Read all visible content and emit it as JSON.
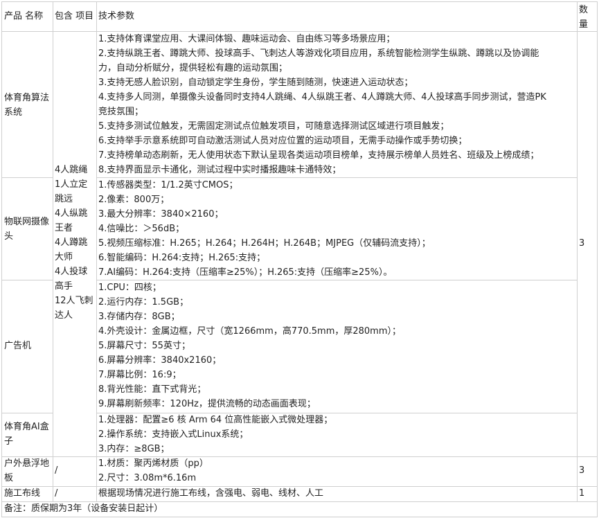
{
  "header": {
    "product_name": "产品 名称",
    "included_items": "包含 项目",
    "tech_params": "技术参数",
    "qty_line1": "数",
    "qty_line2": "量"
  },
  "rows": [
    {
      "product": [
        "体育角算法",
        "系统"
      ],
      "params": [
        "1.支持体育课堂应用、大课间体锻、趣味运动会、自由练习等多场景应用；",
        "2.支持纵跳王者、蹲跳大师、投球高手、飞刺达人等游戏化项目应用，系统智能检测学生纵跳、蹲跳以及协调能",
        "力，自动分析赋分，提供轻松有趣的运动氛围；",
        "3.支持无感人脸识别，自动锁定学生身份，学生随到随测，快速进入运动状态；",
        "4.支持多人同测，单摄像头设备同时支持4人跳绳、4人纵跳王者、4人蹲跳大师、4人投球高手同步测试，营造PK",
        "竞技氛围；",
        "5.支持多测试位触发，无需固定测试点位触发项目，可随意选择测试区域进行项目触发；",
        "6.支持举手示意系统即可自动激活测试人员对应位置的运动项目，无需手动操作或手势切换；",
        "7.支持榜单动态刷新，无人使用状态下默认呈现各类运动项目榜单，支持展示榜单人员姓名、班级及上榜成绩；",
        "8.支持界面显示卡通化，测试过程中实时播报趣味卡通特效；"
      ]
    },
    {
      "product": [
        "物联网摄像",
        "头"
      ],
      "params": [
        "1.传感器类型：1/1.2英寸CMOS；",
        "2.像素：800万；",
        "3.最大分辨率：3840×2160；",
        "4.信噪比：＞56dB；",
        "5.视频压缩标准：H.265；H.264；H.264H；H.264B；MJPEG（仅辅码流支持）；",
        "6.智能编码：H.264:支持；H.265:支持；",
        "7.AI编码：H.264:支持（压缩率≥25%）；H.265:支持（压缩率≥25%）。"
      ]
    },
    {
      "product": [
        "广告机"
      ],
      "params": [
        "1.CPU：四核；",
        "2.运行内存：1.5GB；",
        "3.存储内存：8GB；",
        "4.外壳设计：金属边框，尺寸（宽1266mm，高770.5mm，厚280mm）；",
        "5.屏幕尺寸：55英寸；",
        "6.屏幕分辨率：3840x2160；",
        "7.屏幕比例：16:9；",
        "8.背光性能：直下式背光；",
        "9.屏幕刷新频率：120Hz，提供流畅的动态画面表现；"
      ]
    },
    {
      "product": [
        "体育角AI盒",
        "子"
      ],
      "params": [
        "1.处理器：配置≥6 核 Arm 64 位高性能嵌入式微处理器；",
        "2.操作系统：支持嵌入式Linux系统；",
        "3.内存：≥8GB；"
      ]
    },
    {
      "product": [
        "户外悬浮地",
        "板"
      ],
      "included": "/",
      "params": [
        "1.材质：聚丙烯材质（pp）",
        "2.尺寸：3.08m*6.16m"
      ],
      "qty": "3"
    },
    {
      "product": [
        "施工布线"
      ],
      "included": "/",
      "params": [
        "根据现场情况进行施工布线，含强电、弱电、线材、人工"
      ],
      "qty": "1"
    }
  ],
  "included_items_group": [
    "4人跳绳",
    "1人立定",
    "跳远",
    "4人纵跳",
    "王者",
    "4人蹲跳",
    "大师",
    "4人投球",
    "高手",
    "12人飞刺",
    "达人"
  ],
  "group_qty": "3",
  "footer_note": "备注：质保期为3年（设备安装日起计）"
}
